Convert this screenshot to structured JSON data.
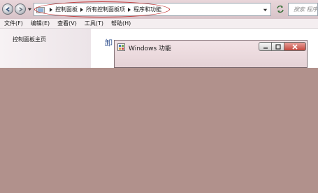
{
  "address_bar": {
    "breadcrumbs": [
      "控制面板",
      "所有控制面板项",
      "程序和功能"
    ],
    "search_placeholder": "搜索 程序",
    "icons": {
      "back": "back-arrow-icon",
      "forward": "forward-arrow-icon",
      "recent": "chevron-down-icon",
      "folder": "control-panel-folder-icon",
      "separator": "breadcrumb-triangle-icon",
      "refresh": "refresh-icon"
    }
  },
  "menu": {
    "items": [
      "文件(F)",
      "编辑(E)",
      "查看(V)",
      "工具(T)",
      "帮助(H)"
    ]
  },
  "left_pane": {
    "home_link": "控制面板主页"
  },
  "main": {
    "title_visible": "卸"
  },
  "dialog": {
    "title": "Windows 功能",
    "icon": "windows-features-icon"
  },
  "colors": {
    "highlight_oval": "#c23a3a",
    "overlay": "#b1918c",
    "title_blue": "#2a4a8a"
  }
}
